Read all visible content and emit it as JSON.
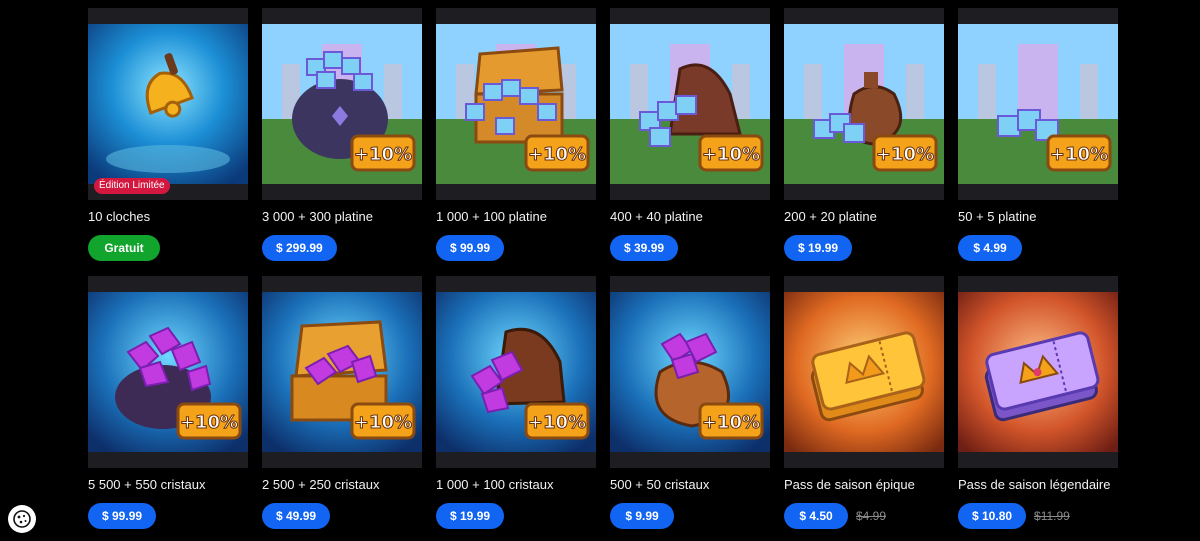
{
  "row1": [
    {
      "title": "10 cloches",
      "price": "Gratuit",
      "free": true,
      "badge": "Édition Limitée",
      "bonus": "",
      "art": "bell"
    },
    {
      "title": "3 000 + 300 platine",
      "price": "$ 299.99",
      "bonus": "+10%",
      "art": "platinum-cauldron"
    },
    {
      "title": "1 000 + 100 platine",
      "price": "$ 99.99",
      "bonus": "+10%",
      "art": "platinum-chest"
    },
    {
      "title": "400 + 40 platine",
      "price": "$ 39.99",
      "bonus": "+10%",
      "art": "platinum-hat"
    },
    {
      "title": "200 + 20 platine",
      "price": "$ 19.99",
      "bonus": "+10%",
      "art": "platinum-bag"
    },
    {
      "title": "50 + 5 platine",
      "price": "$ 4.99",
      "bonus": "+10%",
      "art": "platinum-small"
    }
  ],
  "row2": [
    {
      "title": "5 500 + 550 cristaux",
      "price": "$ 99.99",
      "bonus": "+10%",
      "art": "crystal-cauldron"
    },
    {
      "title": "2 500 + 250 cristaux",
      "price": "$ 49.99",
      "bonus": "+10%",
      "art": "crystal-chest"
    },
    {
      "title": "1 000 + 100 cristaux",
      "price": "$ 19.99",
      "bonus": "+10%",
      "art": "crystal-hat"
    },
    {
      "title": "500 + 50 cristaux",
      "price": "$ 9.99",
      "bonus": "+10%",
      "art": "crystal-bag"
    },
    {
      "title": "Pass de saison épique",
      "price": "$ 4.50",
      "old_price": "$4.99",
      "bonus": "",
      "art": "epic-pass"
    },
    {
      "title": "Pass de saison légendaire",
      "price": "$ 10.80",
      "old_price": "$11.99",
      "bonus": "",
      "art": "legendary-pass"
    }
  ],
  "colors": {
    "price_button": "#1264f2",
    "free_button": "#12a52e",
    "limited_badge": "#d3173f",
    "bonus_badge": "#f3a21a"
  },
  "cookie_icon": "cookie-icon"
}
